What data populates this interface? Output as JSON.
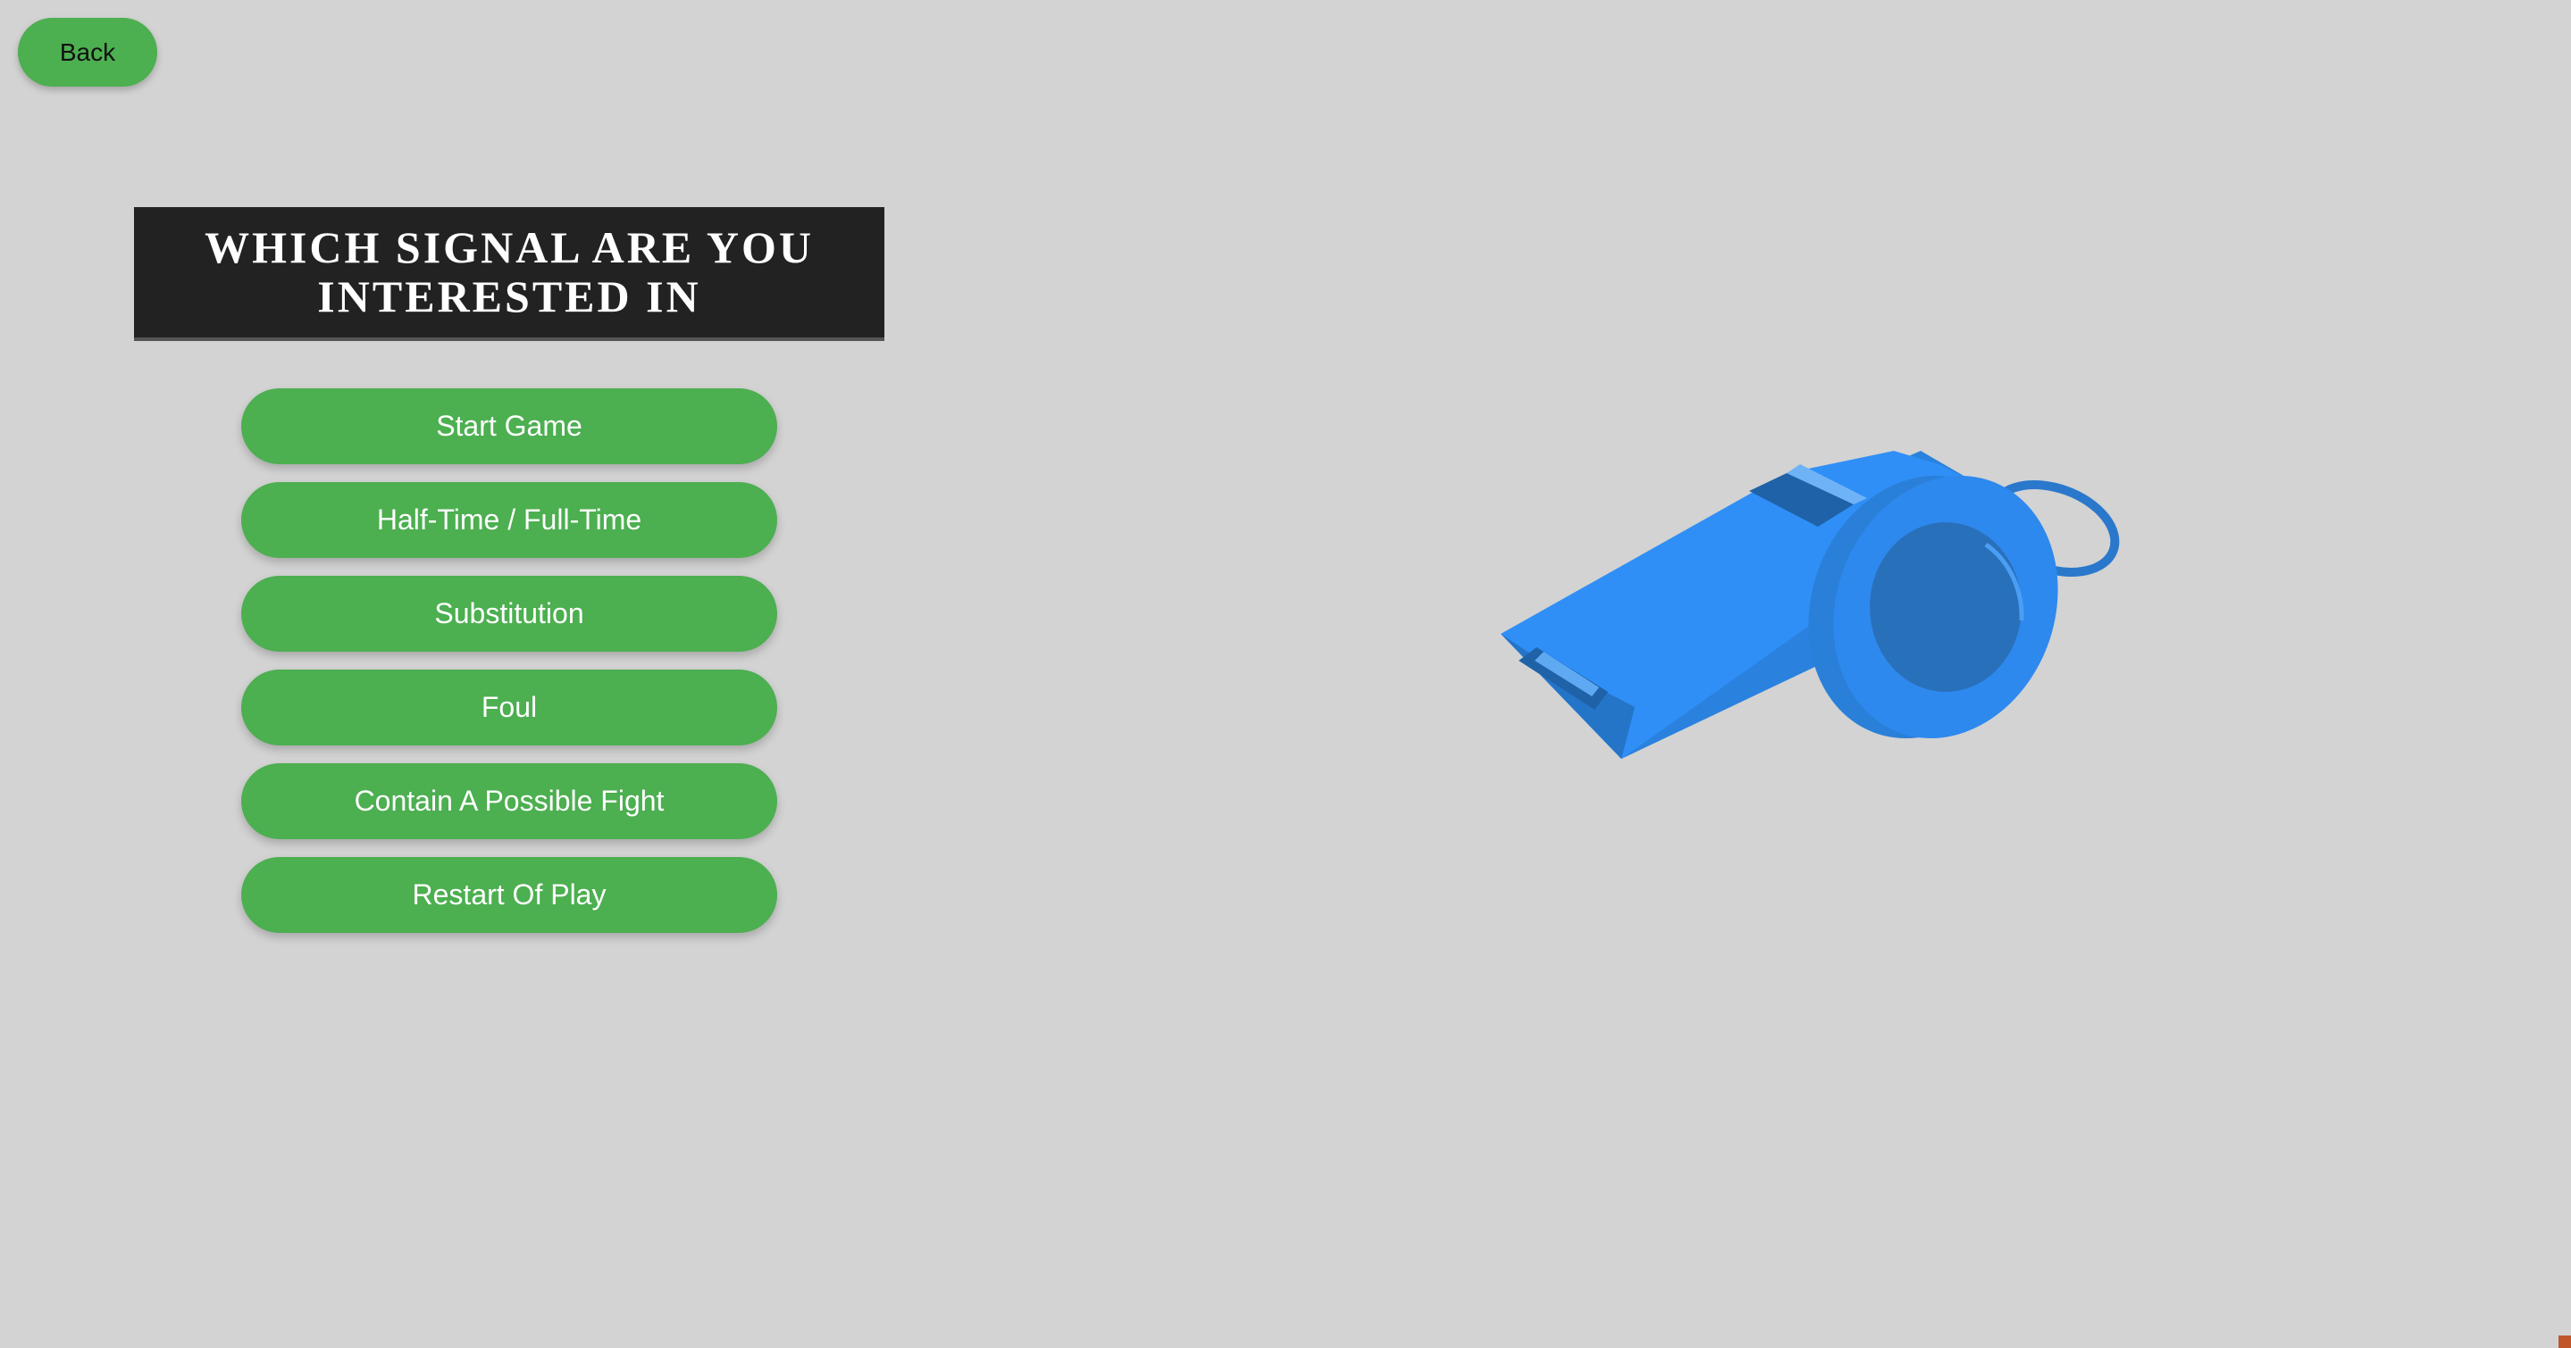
{
  "nav": {
    "back_label": "Back"
  },
  "header": {
    "title": "WHICH SIGNAL ARE YOU INTERESTED IN"
  },
  "signals": [
    {
      "label": "Start Game"
    },
    {
      "label": "Half-Time / Full-Time"
    },
    {
      "label": "Substitution"
    },
    {
      "label": "Foul"
    },
    {
      "label": "Contain A Possible Fight"
    },
    {
      "label": "Restart Of Play"
    }
  ],
  "illustration": {
    "icon": "whistle-icon"
  },
  "colors": {
    "background": "#d3d3d3",
    "button": "#4caf50",
    "title_bg": "#222222",
    "whistle": "#2e8ef5"
  }
}
